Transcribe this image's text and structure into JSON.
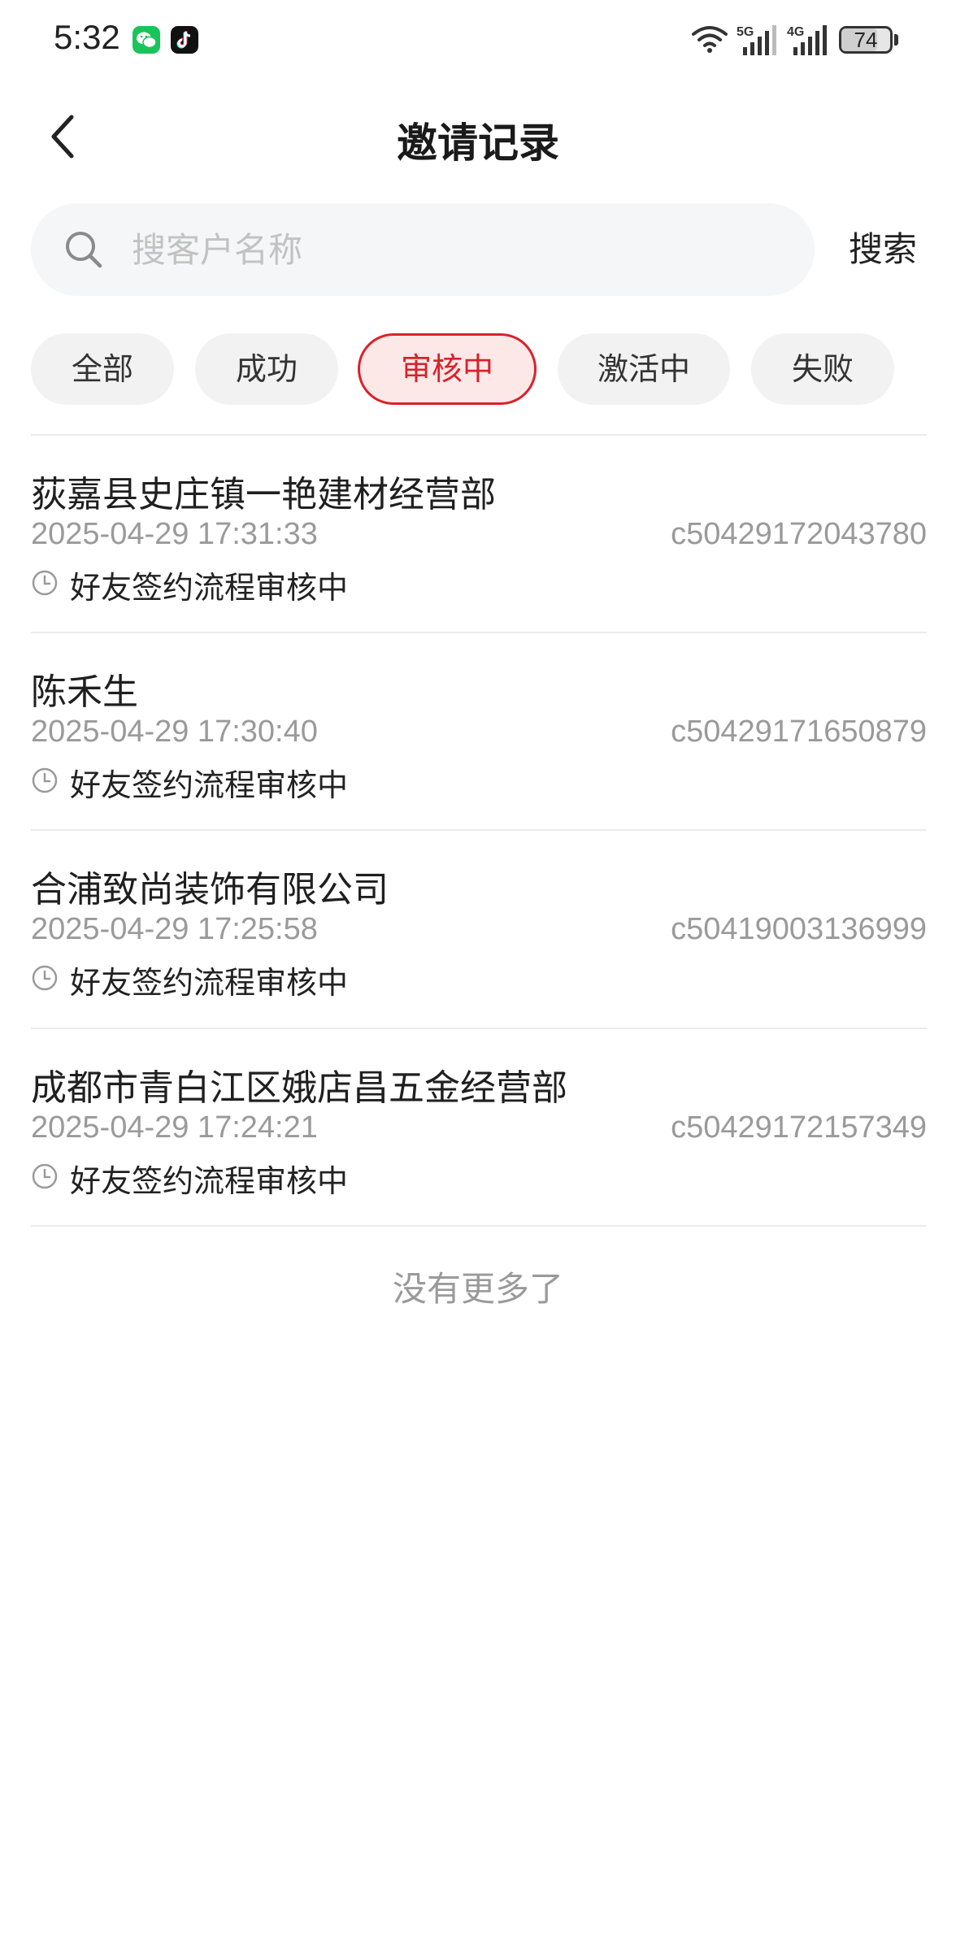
{
  "status_bar": {
    "time": "5:32",
    "battery": "74",
    "battery_level": 0.74,
    "network_5g": "5G",
    "network_4g": "4G",
    "icons": [
      "wechat-icon",
      "tiktok-icon",
      "wifi-icon",
      "signal-5g-icon",
      "signal-4g-icon",
      "battery-icon"
    ]
  },
  "header": {
    "title": "邀请记录",
    "back_icon": "chevron-left-icon"
  },
  "search": {
    "placeholder": "搜客户名称",
    "value": "",
    "button_label": "搜索",
    "icon": "search-icon"
  },
  "tabs": [
    {
      "label": "全部",
      "active": false
    },
    {
      "label": "成功",
      "active": false
    },
    {
      "label": "审核中",
      "active": true
    },
    {
      "label": "激活中",
      "active": false
    },
    {
      "label": "失败",
      "active": false
    }
  ],
  "records": [
    {
      "name": "荻嘉县史庄镇一艳建材经营部",
      "time": "2025-04-29 17:31:33",
      "id": "c50429172043780",
      "status": "好友签约流程审核中"
    },
    {
      "name": "陈禾生",
      "time": "2025-04-29 17:30:40",
      "id": "c50429171650879",
      "status": "好友签约流程审核中"
    },
    {
      "name": "合浦致尚装饰有限公司",
      "time": "2025-04-29 17:25:58",
      "id": "c50419003136999",
      "status": "好友签约流程审核中"
    },
    {
      "name": "成都市青白江区娥店昌五金经营部",
      "time": "2025-04-29 17:24:21",
      "id": "c50429172157349",
      "status": "好友签约流程审核中"
    }
  ],
  "footer": {
    "no_more": "没有更多了"
  },
  "colors": {
    "accent": "#d8222a",
    "accent_bg": "#fde8e8",
    "muted_text": "#9a9a9a"
  }
}
